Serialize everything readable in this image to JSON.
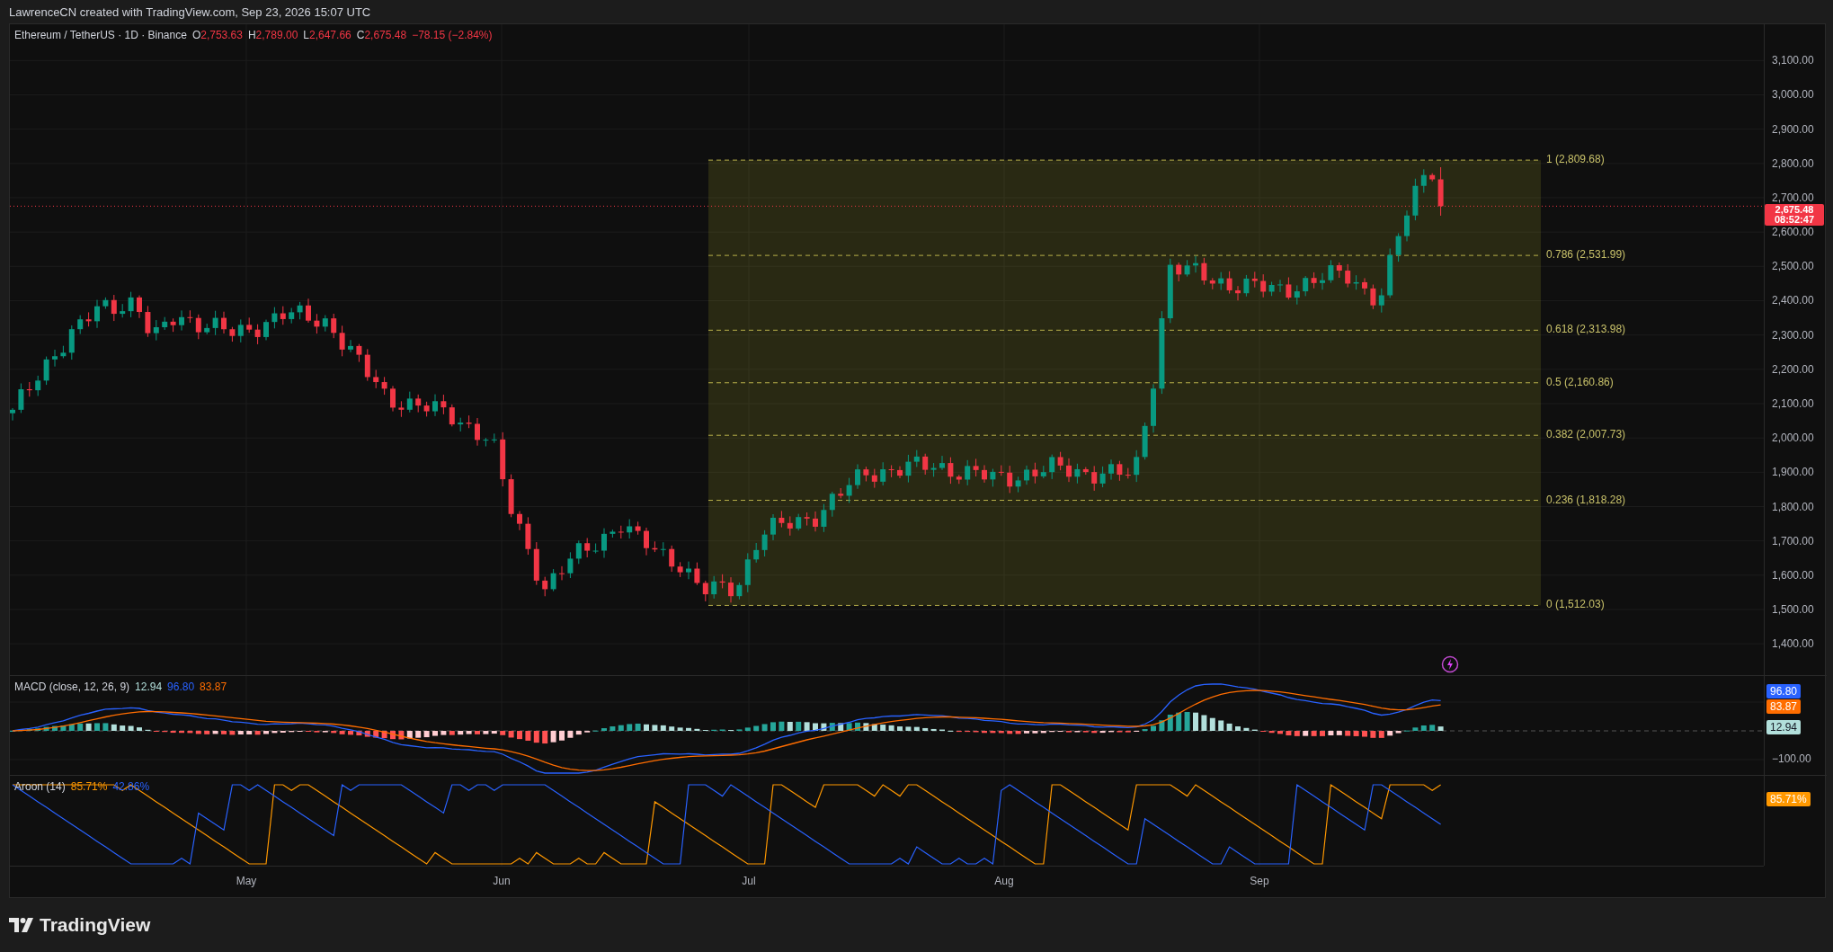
{
  "header": {
    "attribution": "LawrenceCN created with TradingView.com, Sep 23, 2026 15:07 UTC"
  },
  "legend": {
    "symbol": "Ethereum / TetherUS · 1D · Binance",
    "ohlc": [
      {
        "key": "O",
        "value": "2,753.63"
      },
      {
        "key": "H",
        "value": "2,789.00"
      },
      {
        "key": "L",
        "value": "2,647.66"
      },
      {
        "key": "C",
        "value": "2,675.48"
      }
    ],
    "change": "−78.15 (−2.84%)"
  },
  "price_axis": {
    "labels": [
      "3,100.00",
      "3,000.00",
      "2,900.00",
      "2,800.00",
      "2,700.00",
      "2,600.00",
      "2,500.00",
      "2,400.00",
      "2,300.00",
      "2,200.00",
      "2,100.00",
      "2,000.00",
      "1,900.00",
      "1,800.00",
      "1,700.00",
      "1,600.00",
      "1,500.00",
      "1,400.00"
    ]
  },
  "price_tag": {
    "price": "2,675.48",
    "countdown": "08:52:47"
  },
  "fibonacci": {
    "levels": [
      {
        "label": "1 (2,809.68)"
      },
      {
        "label": "0.786 (2,531.99)"
      },
      {
        "label": "0.618 (2,313.98)"
      },
      {
        "label": "0.5 (2,160.86)"
      },
      {
        "label": "0.382 (2,007.73)"
      },
      {
        "label": "0.236 (1,818.28)"
      },
      {
        "label": "0 (1,512.03)"
      }
    ]
  },
  "macd": {
    "title": "MACD (close, 12, 26, 9)",
    "values": [
      {
        "text": "12.94",
        "kind": "histogram"
      },
      {
        "text": "96.80",
        "kind": "macd"
      },
      {
        "text": "83.87",
        "kind": "signal"
      }
    ],
    "axis_tags": [
      {
        "text": "96.80",
        "kind": "macd"
      },
      {
        "text": "83.87",
        "kind": "signal"
      },
      {
        "text": "12.94",
        "kind": "histogram"
      }
    ],
    "axis_labels": [
      "−100.00"
    ]
  },
  "aroon": {
    "title": "Aroon (14)",
    "values": [
      {
        "text": "85.71%",
        "kind": "up"
      },
      {
        "text": "42.86%",
        "kind": "down"
      }
    ],
    "axis_tags": [
      {
        "text": "85.71%",
        "kind": "up"
      }
    ]
  },
  "time_axis": {
    "labels": [
      "May",
      "Jun",
      "Jul",
      "Aug",
      "Sep"
    ]
  },
  "footer": {
    "logo": "TradingView"
  }
}
